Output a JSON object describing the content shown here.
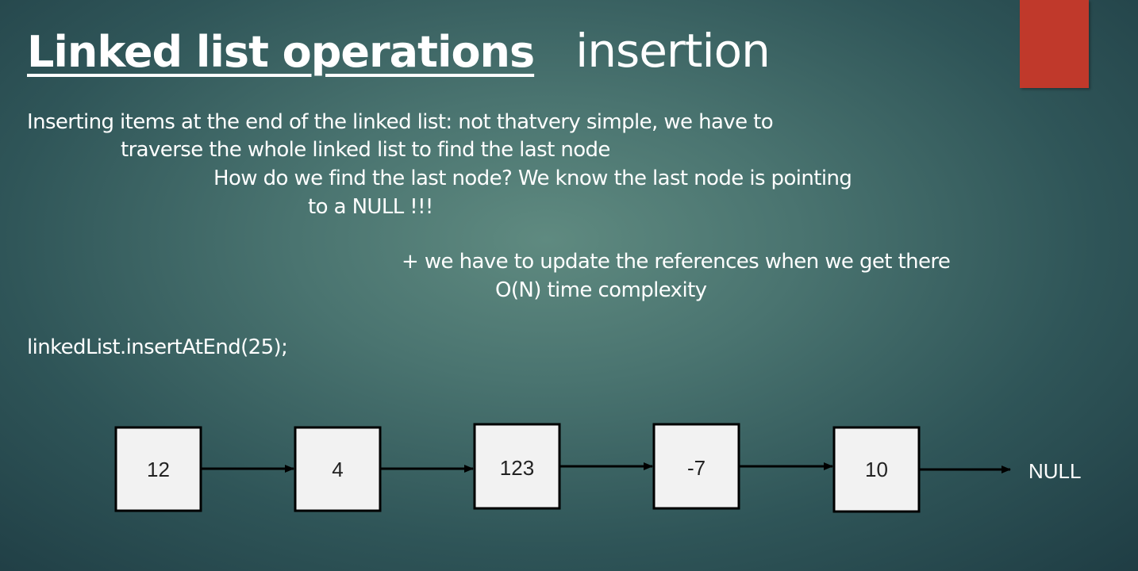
{
  "slide": {
    "title_main": "Linked list operations",
    "title_sub": "insertion",
    "accent_color": "#c0392b",
    "body_lines": [
      "Inserting items at the end of the linked list: not thatvery simple, we have to",
      "traverse the whole linked list to find the last node",
      "How do we find the last node? We know the last node is pointing",
      "to a NULL !!!",
      "+ we have to update the references when we get there",
      "O(N) time complexity"
    ],
    "code_line": "linkedList.insertAtEnd(25);"
  },
  "diagram": {
    "nodes": [
      "12",
      "4",
      "123",
      "-7",
      "10"
    ],
    "terminal_label": "NULL"
  }
}
